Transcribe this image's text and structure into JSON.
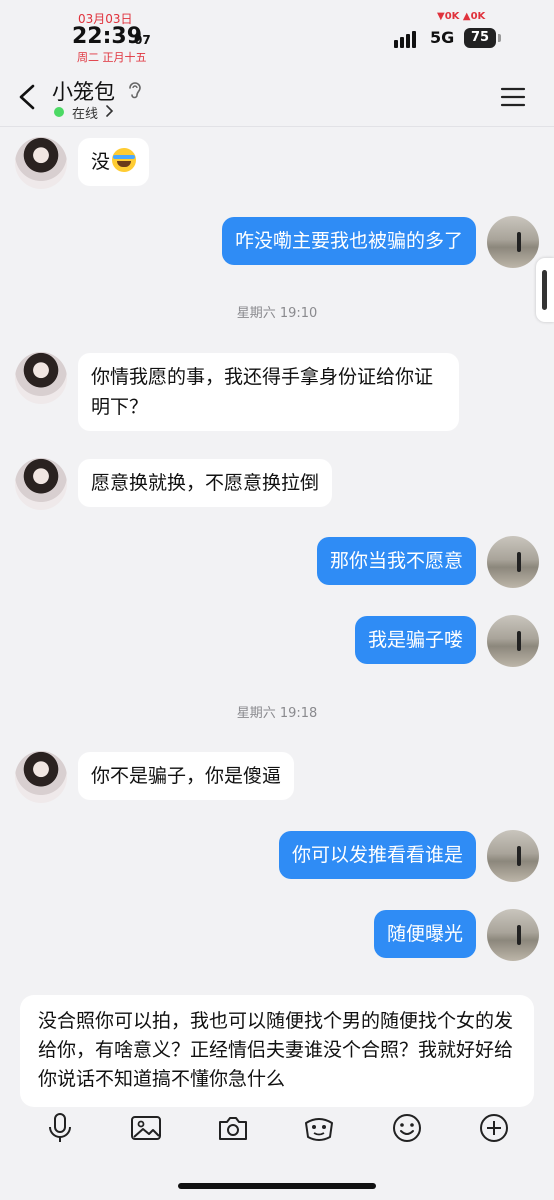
{
  "status": {
    "date": "03月03日",
    "time": "22:39",
    "seconds": "07",
    "lunar": "周二 正月十五",
    "net_speed": "▼0K ▲0K",
    "network": "5G",
    "battery": "75"
  },
  "header": {
    "contact_name": "小笼包",
    "presence": "在线"
  },
  "messages": [
    {
      "side": "in",
      "text": "没"
    },
    {
      "side": "out",
      "text": "咋没嘞主要我也被骗的多了"
    },
    {
      "side": "time",
      "text": "星期六 19:10"
    },
    {
      "side": "in",
      "text": "你情我愿的事，我还得手拿身份证给你证明下？"
    },
    {
      "side": "in",
      "text": "愿意换就换，不愿意换拉倒"
    },
    {
      "side": "out",
      "text": "那你当我不愿意"
    },
    {
      "side": "out",
      "text": "我是骗子喽"
    },
    {
      "side": "time",
      "text": "星期六 19:18"
    },
    {
      "side": "in",
      "text": "你不是骗子，你是傻逼"
    },
    {
      "side": "out",
      "text": "你可以发推看看谁是"
    },
    {
      "side": "out",
      "text": "随便曝光"
    }
  ],
  "composer": {
    "draft": "没合照你可以拍，我也可以随便找个男的随便找个女的发给你，有啥意义？正经情侣夫妻谁没个合照？我就好好给你说话不知道搞不懂你急什么"
  },
  "toolbar": [
    "microphone-icon",
    "image-icon",
    "camera-icon",
    "red-packet-icon",
    "emoji-icon",
    "plus-icon"
  ],
  "colors": {
    "outgoing_bubble": "#2f8cf5",
    "incoming_bubble": "#ffffff",
    "online": "#4cd964"
  }
}
